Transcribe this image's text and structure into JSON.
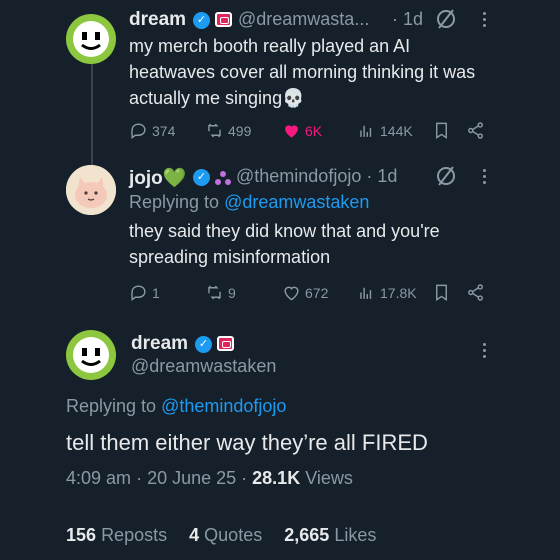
{
  "tweet1": {
    "name": "dream",
    "handle": "@dreamwasta...",
    "time": "· 1d",
    "text": "my merch booth really played an AI heatwaves cover all morning thinking it was actually me singing",
    "emoji": "💀",
    "replies": "374",
    "reposts": "499",
    "likes": "6K",
    "views": "144K"
  },
  "tweet2": {
    "name": "jojo",
    "emoji": "💚",
    "handle": "@themindofjojo · 1d",
    "replying_prefix": "Replying to ",
    "replying_to": "@dreamwastaken",
    "text": "they said they did know that and you're spreading misinformation",
    "replies": "1",
    "reposts": "9",
    "likes": "672",
    "views": "17.8K"
  },
  "main": {
    "name": "dream",
    "handle": "@dreamwastaken",
    "replying_prefix": "Replying to ",
    "replying_to": "@themindofjojo",
    "text": "tell them either way they’re all FIRED",
    "time": "4:09 am",
    "date": "20 June 25",
    "views_count": "28.1K",
    "views_label": "Views",
    "reposts_count": "156",
    "reposts_label": "Reposts",
    "quotes_count": "4",
    "quotes_label": "Quotes",
    "likes_count": "2,665",
    "likes_label": "Likes"
  },
  "icons": [
    "verified-icon",
    "game-controller-badge-icon",
    "grok-icon",
    "more-icon",
    "reply-icon",
    "repost-icon",
    "heart-icon",
    "views-icon",
    "bookmark-icon",
    "share-icon",
    "people-badge-icon"
  ],
  "colors": {
    "background": "#15202b",
    "accent": "#1d9bf0",
    "like": "#f91880",
    "muted": "#8b98a5"
  }
}
